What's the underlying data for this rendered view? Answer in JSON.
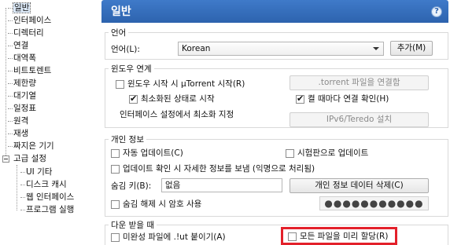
{
  "tree": {
    "items": [
      {
        "label": "일반",
        "selected": true
      },
      {
        "label": "인터페이스"
      },
      {
        "label": "디렉터리"
      },
      {
        "label": "연결"
      },
      {
        "label": "대역폭"
      },
      {
        "label": "비트토렌트"
      },
      {
        "label": "제한량"
      },
      {
        "label": "대기열"
      },
      {
        "label": "일정표"
      },
      {
        "label": "원격"
      },
      {
        "label": "재생"
      },
      {
        "label": "짜지은 기기"
      },
      {
        "label": "고급 설정"
      }
    ],
    "children": [
      {
        "label": "UI 기타"
      },
      {
        "label": "디스크 캐시"
      },
      {
        "label": "웹 인터페이스"
      },
      {
        "label": "프로그램 실행"
      }
    ]
  },
  "header": {
    "title": "일반",
    "help": "?"
  },
  "language": {
    "group_label": "언어",
    "field_label": "언어(L):",
    "selected": "Korean",
    "add_button": "추가(M)"
  },
  "windows": {
    "group_label": "윈도우 연계",
    "start_on_boot": {
      "label": "윈도우 시작 시 µTorrent 시작(R)",
      "checked": false
    },
    "start_minimized": {
      "label": "최소화된 상태로 시작",
      "checked": true
    },
    "check_association": {
      "label": "켤 때마다 연결 확인(H)",
      "checked": true
    },
    "associate_button": ".torrent 파일을 연결함",
    "minimize_text": "인터페이스 설정에서 최소화 지정",
    "ipv6_button": "IPv6/Teredo 설치"
  },
  "privacy": {
    "group_label": "개인 정보",
    "auto_update": {
      "label": "자동 업데이트(C)",
      "checked": false
    },
    "beta_update": {
      "label": "시험판으로 업데이트",
      "checked": false
    },
    "send_info": {
      "label": "업데이트 확인 시 자세한 정보를 보냄 (익명으로 처리됨)",
      "checked": false
    },
    "boss_key_label": "숨김 키(B):",
    "boss_key_value": "없음",
    "delete_button": "개인 정보 데이터 삭제(C)",
    "password_on_unhide": {
      "label": "숨김 해제 시 암호 사용",
      "checked": false
    },
    "password_value": "●●●●●●●●●●●"
  },
  "downloading": {
    "group_label": "다운 받을 때",
    "append_ut": {
      "label": "미완성 파일에 .!ut 붙이기(A)",
      "checked": false
    },
    "preallocate": {
      "label": "모든 파일을 미리 할당(R)",
      "checked": false
    }
  }
}
